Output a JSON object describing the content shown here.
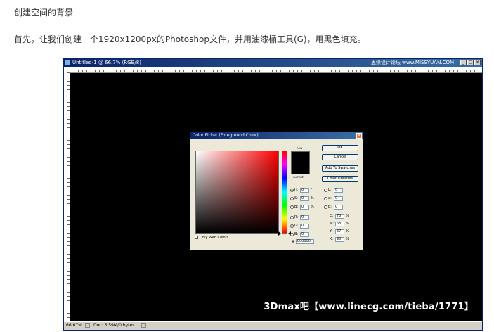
{
  "article": {
    "heading": "创建空间的背景",
    "paragraph": "首先，让我们创建一个1920x1200px的Photoshop文件，并用油漆桶工具(G)，用黑色填充。"
  },
  "photoshop": {
    "window_title": "Untitled-1 @ 66.7% (RGB/8)",
    "title_watermark": "思缘设计论坛 www.MISSYUAN.COM",
    "zoom": "66.67%",
    "doc_info": "Doc: 6.59M/0 bytes",
    "canvas_color": "#000000",
    "watermark": "3Dmax吧【www.linecg.com/tieba/1771】"
  },
  "color_picker": {
    "title": "Color Picker (Foreground Color)",
    "new_label": "new",
    "current_label": "current",
    "buttons": {
      "ok": "OK",
      "cancel": "Cancel",
      "add_to_swatches": "Add To Swatches",
      "color_libraries": "Color Libraries"
    },
    "hsb": {
      "h": {
        "label": "H:",
        "value": "0",
        "unit": "°"
      },
      "s": {
        "label": "S:",
        "value": "0",
        "unit": "%"
      },
      "b": {
        "label": "B:",
        "value": "0",
        "unit": "%"
      }
    },
    "rgb": {
      "r": {
        "label": "R:",
        "value": "0"
      },
      "g": {
        "label": "G:",
        "value": "0"
      },
      "b": {
        "label": "B:",
        "value": "0"
      }
    },
    "lab": {
      "l": {
        "label": "L:",
        "value": "0"
      },
      "a": {
        "label": "a:",
        "value": "0"
      },
      "b": {
        "label": "b:",
        "value": "0"
      }
    },
    "cmyk": {
      "c": {
        "label": "C:",
        "value": "75",
        "unit": "%"
      },
      "m": {
        "label": "M:",
        "value": "68",
        "unit": "%"
      },
      "y": {
        "label": "Y:",
        "value": "67",
        "unit": "%"
      },
      "k": {
        "label": "K:",
        "value": "90",
        "unit": "%"
      }
    },
    "only_web_colors": "Only Web Colors",
    "hex_label": "#",
    "hex_value": "000000",
    "selected_color": "#000000"
  }
}
